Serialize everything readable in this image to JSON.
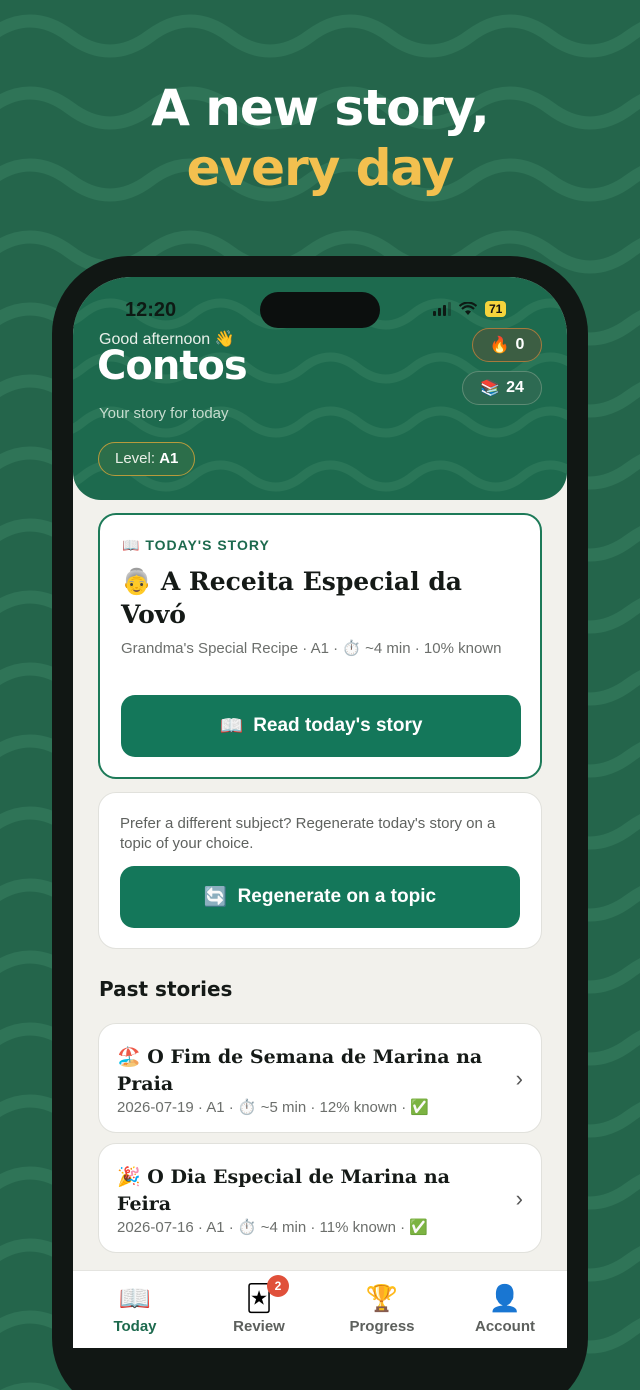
{
  "promo": {
    "headline_line1": "A new story,",
    "headline_line2": "every day"
  },
  "status_bar": {
    "time": "12:20",
    "battery": "71"
  },
  "header": {
    "greeting": "Good afternoon 👋",
    "app_title": "Contos",
    "subtitle": "Your story for today",
    "level_label": "Level:",
    "level_value": "A1",
    "streak_icon": "🔥",
    "streak_count": "0",
    "books_icon": "📚",
    "books_count": "24"
  },
  "today_card": {
    "label": "📖 TODAY'S STORY",
    "title": "👵 A Receita Especial da Vovó",
    "meta": "Grandma's Special Recipe · A1 · ⏱️ ~4 min · 10% known",
    "button_icon": "📖",
    "button_label": "Read today's story"
  },
  "regen_card": {
    "text": "Prefer a different subject? Regenerate today's story on a topic of your choice.",
    "button_icon": "🔄",
    "button_label": "Regenerate on a topic"
  },
  "past": {
    "heading": "Past stories",
    "items": [
      {
        "title": "🏖️ O Fim de Semana de Marina na Praia",
        "meta": "2026-07-19 · A1 · ⏱️ ~5 min · 12% known · ✅"
      },
      {
        "title": "🎉 O Dia Especial de Marina na Feira",
        "meta": "2026-07-16 · A1 · ⏱️ ~4 min · 11% known · ✅"
      }
    ]
  },
  "tabs": [
    {
      "icon": "📖",
      "label": "Today",
      "active": true
    },
    {
      "icon": "🃏",
      "label": "Review",
      "badge": "2"
    },
    {
      "icon": "🏆",
      "label": "Progress"
    },
    {
      "icon": "👤",
      "label": "Account"
    }
  ],
  "colors": {
    "background": "#24654b",
    "header": "#1d6a4e",
    "accent_yellow": "#f3c04f",
    "button": "#14775a"
  }
}
